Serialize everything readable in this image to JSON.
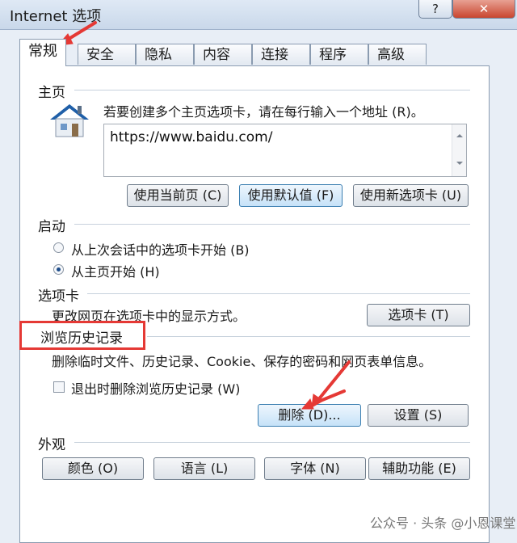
{
  "window": {
    "title": "Internet 选项",
    "help_label": "?",
    "close_label": "✕"
  },
  "tabs": [
    {
      "label": "常规"
    },
    {
      "label": "安全"
    },
    {
      "label": "隐私"
    },
    {
      "label": "内容"
    },
    {
      "label": "连接"
    },
    {
      "label": "程序"
    },
    {
      "label": "高级"
    }
  ],
  "home": {
    "title": "主页",
    "description": "若要创建多个主页选项卡，请在每行输入一个地址 (R)。",
    "url": "https://www.baidu.com/",
    "buttons": {
      "current": "使用当前页 (C)",
      "default": "使用默认值 (F)",
      "new_tab": "使用新选项卡 (U)"
    }
  },
  "startup": {
    "title": "启动",
    "options": [
      {
        "label": "从上次会话中的选项卡开始 (B)",
        "selected": false
      },
      {
        "label": "从主页开始 (H)",
        "selected": true
      }
    ]
  },
  "tabs_section": {
    "title": "选项卡",
    "description": "更改网页在选项卡中的显示方式。",
    "button": "选项卡 (T)"
  },
  "history": {
    "title": "浏览历史记录",
    "description": "删除临时文件、历史记录、Cookie、保存的密码和网页表单信息。",
    "checkbox_label": "退出时删除浏览历史记录 (W)",
    "checkbox_checked": false,
    "delete_button": "删除 (D)...",
    "settings_button": "设置 (S)"
  },
  "appearance": {
    "title": "外观",
    "buttons": {
      "colors": "颜色 (O)",
      "languages": "语言 (L)",
      "fonts": "字体 (N)",
      "accessibility": "辅助功能 (E)"
    }
  },
  "watermark": "公众号 · 头条 @小恩课堂",
  "colors": {
    "accent_red": "#e53935",
    "selected_button_blue": "#3c7fb1"
  }
}
